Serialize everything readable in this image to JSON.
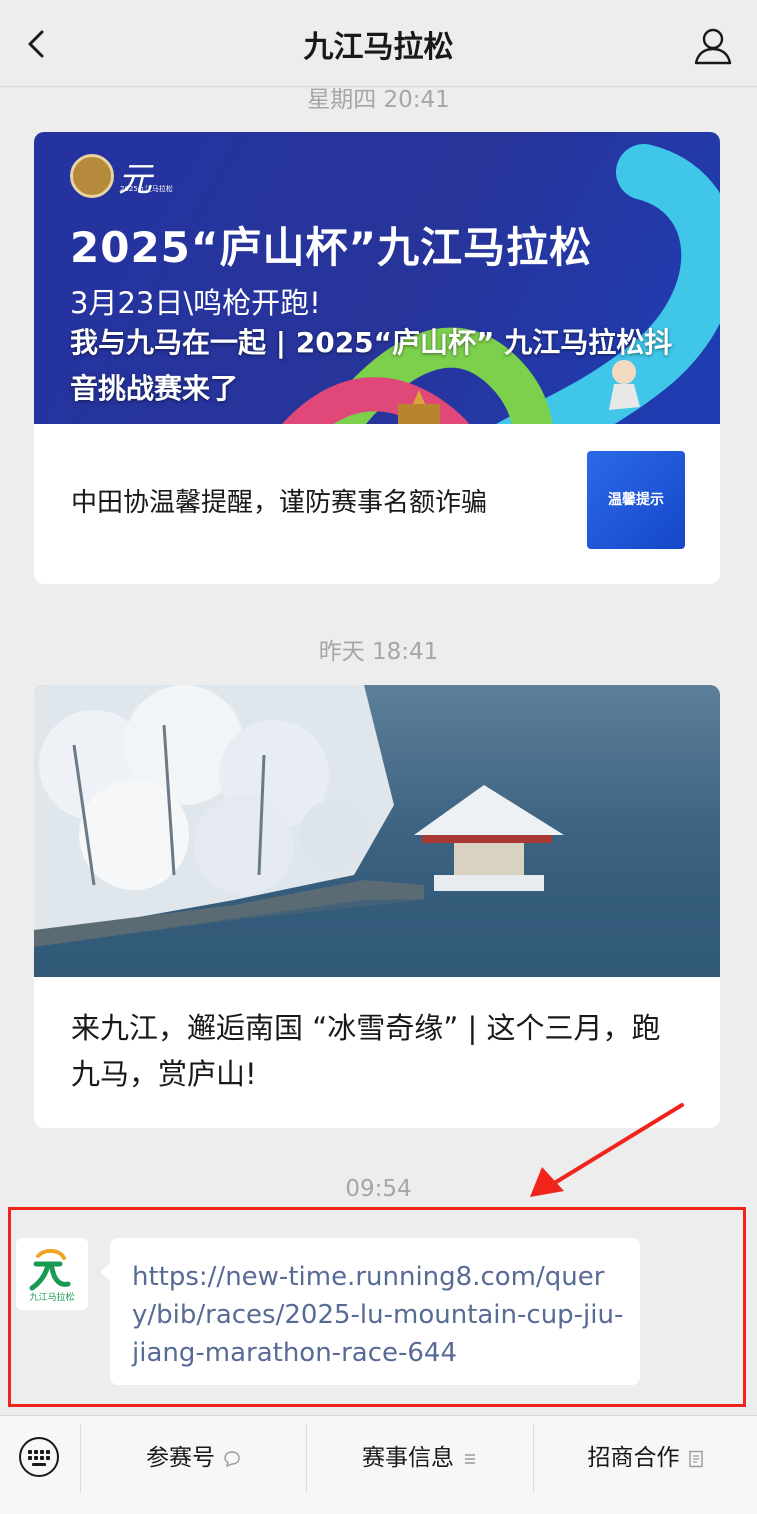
{
  "navbar": {
    "title": "九江马拉松",
    "back_icon": "chevron-left-icon",
    "profile_icon": "person-icon"
  },
  "timestamps": [
    "星期四 20:41",
    "昨天 18:41",
    "09:54"
  ],
  "article1": {
    "logo_text": "2025九江马拉松",
    "cover_title": "2025“庐山杯”九江马拉松",
    "cover_date": "3月23日\\鸣枪开跑!",
    "headline": "我与九马在一起 | 2025“庐山杯” 九江马拉松抖音挑战赛来了",
    "sub_title": "中田协温馨提醒，谨防赛事名额诈骗",
    "thumb_text": "温馨提示"
  },
  "article2": {
    "title": "来九江，邂逅南国 “冰雪奇缘” | 这个三月，跑九马，赏庐山!"
  },
  "message": {
    "avatar_text": "九江马拉松",
    "text": "https://new-time.running8.com/query/bib/races/2025-lu-mountain-cup-jiu-jiang-marathon-race-644"
  },
  "menu": {
    "keyboard_icon": "keyboard-icon",
    "items": [
      {
        "label": "参赛号",
        "icon": "chat-bubble-icon"
      },
      {
        "label": "赛事信息",
        "icon": "menu-lines-icon"
      },
      {
        "label": "招商合作",
        "icon": "document-icon"
      }
    ]
  },
  "colors": {
    "background": "#ededed",
    "link": "#576b95",
    "annotation": "#f0241b"
  }
}
